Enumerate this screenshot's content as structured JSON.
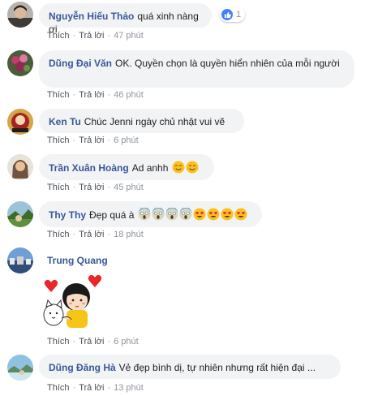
{
  "actions": {
    "like": "Thích",
    "reply": "Trả lời",
    "separator": "·"
  },
  "comments": [
    {
      "name": "Nguyễn Hiếu Thảo",
      "text": "quá xinh nàng ơi",
      "time": "47 phút",
      "reaction_count": "1",
      "avatar_icon": "avatar-photo-icon"
    },
    {
      "name": "Dũng Đại Văn",
      "text": "OK. Quyền chọn là quyền hiển nhiên của mỗi người",
      "time": "46 phút",
      "avatar_icon": "avatar-photo-icon"
    },
    {
      "name": "Ken Tu",
      "text": "Chúc Jenni ngày chủ nhật vui vẽ",
      "time": "6 phút",
      "avatar_icon": "avatar-photo-icon"
    },
    {
      "name": "Trần Xuân Hoàng",
      "text": "Ad anhh",
      "time": "45 phút",
      "emojis": [
        "smiling-face-icon",
        "smiling-face-icon"
      ],
      "avatar_icon": "avatar-photo-icon"
    },
    {
      "name": "Thy Thy",
      "text": "Đẹp quá à",
      "time": "18 phút",
      "emojis": [
        "screaming-face-icon",
        "screaming-face-icon",
        "screaming-face-icon",
        "screaming-face-icon",
        "heart-eyes-face-icon",
        "heart-eyes-face-icon",
        "heart-eyes-face-icon",
        "heart-eyes-face-icon"
      ],
      "avatar_icon": "avatar-photo-icon"
    },
    {
      "name": "Trung Quang",
      "text": "",
      "time": "6 phút",
      "sticker": "girl-and-cat-hearts-sticker",
      "avatar_icon": "avatar-photo-icon"
    },
    {
      "name": "Dũng Đăng Hà",
      "text": "Vẻ đẹp bình dị, tự nhiên nhưng rất hiện đại ...",
      "time": "13 phút",
      "avatar_icon": "avatar-photo-icon"
    }
  ],
  "colors": {
    "name": "#385898",
    "bubble": "#f2f3f5",
    "meta": "#90949c",
    "like_badge": "#4080ff"
  }
}
